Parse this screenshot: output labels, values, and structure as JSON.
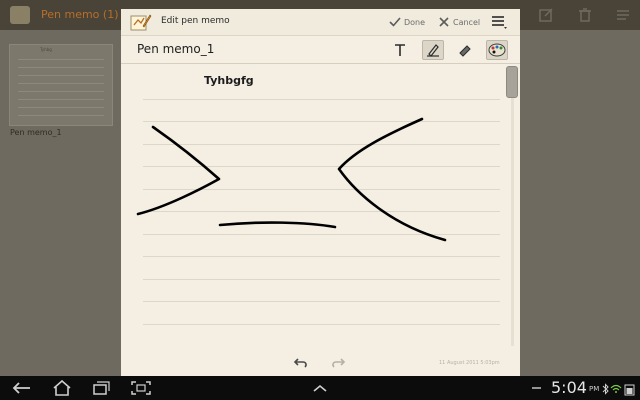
{
  "background_app": {
    "title": "Pen memo (1)",
    "thumbnail_title": "Tyhbg",
    "thumbnail_caption": "Pen memo_1"
  },
  "dialog": {
    "title": "Edit pen memo",
    "done_label": "Done",
    "cancel_label": "Cancel",
    "memo_title": "Pen memo_1",
    "note_text": "Tyhbgfg",
    "timestamp": "11 August 2011 5:03pm"
  },
  "toolbar": {
    "tools": [
      "text-icon",
      "pen-icon",
      "eraser-icon",
      "palette-icon"
    ],
    "selected_tool": "pen-icon"
  },
  "system_bar": {
    "time": "5:04",
    "ampm": "PM"
  },
  "colors": {
    "accent": "#b56f2a",
    "paper": "#f4efe2",
    "ink": "#000000"
  }
}
